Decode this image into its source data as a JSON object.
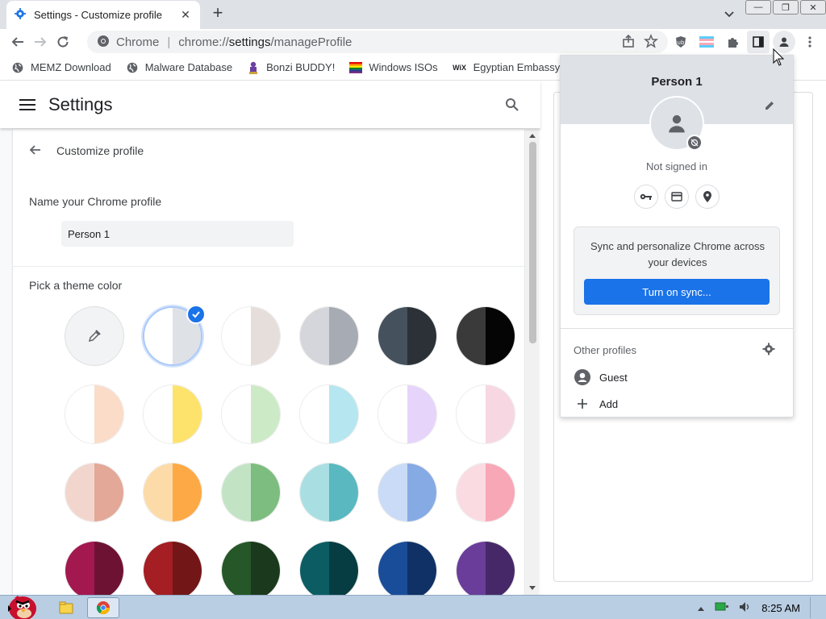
{
  "browser": {
    "tab": {
      "title": "Settings - Customize profile",
      "close": "✕",
      "icon": "gear-icon"
    },
    "new_tab": "+",
    "window_buttons": [
      "—",
      "❐",
      "✕"
    ],
    "omnibox": {
      "label": "Chrome",
      "separator": "|",
      "url_prefix": "chrome://",
      "url_highlight": "settings",
      "url_suffix": "/manageProfile"
    },
    "bookmarks": [
      {
        "label": "MEMZ Download",
        "icon": "globe-icon"
      },
      {
        "label": "Malware Database",
        "icon": "globe-icon"
      },
      {
        "label": "Bonzi BUDDY!",
        "icon": "bonzi-icon"
      },
      {
        "label": "Windows ISOs",
        "icon": "rainbow-flag-icon"
      },
      {
        "label": "Egyptian Embassy",
        "icon": "wix-icon",
        "icon_text": "WiX"
      }
    ]
  },
  "settings": {
    "header_title": "Settings",
    "page_title": "Customize profile",
    "name_label": "Name your Chrome profile",
    "name_value": "Person 1",
    "theme_label": "Pick a theme color",
    "swatches": [
      {
        "left": "#ffffff",
        "right": "#ffffff",
        "picker": true
      },
      {
        "left": "#ffffff",
        "right": "#dee1e6",
        "selected": true
      },
      {
        "left": "#ffffff",
        "right": "#e6dedb"
      },
      {
        "left": "#d4d6db",
        "right": "#a7abb3"
      },
      {
        "left": "#45515c",
        "right": "#2b3137"
      },
      {
        "left": "#3a3a3a",
        "right": "#050505"
      },
      {
        "left": "#ffffff",
        "right": "#fbdcc9"
      },
      {
        "left": "#ffffff",
        "right": "#fde36b"
      },
      {
        "left": "#ffffff",
        "right": "#cdeac6"
      },
      {
        "left": "#ffffff",
        "right": "#b6e6ef"
      },
      {
        "left": "#ffffff",
        "right": "#e6d4fb"
      },
      {
        "left": "#ffffff",
        "right": "#f7d7e2"
      },
      {
        "left": "#f2d6cd",
        "right": "#e3a898"
      },
      {
        "left": "#fddba8",
        "right": "#fda945"
      },
      {
        "left": "#c2e3c4",
        "right": "#7dbd7f"
      },
      {
        "left": "#a9dfe2",
        "right": "#5ab8c0"
      },
      {
        "left": "#c9dbf6",
        "right": "#86aae4"
      },
      {
        "left": "#fbdbe2",
        "right": "#f8a7b6"
      },
      {
        "left": "#a3184f",
        "right": "#6e1234"
      },
      {
        "left": "#a41e23",
        "right": "#721618"
      },
      {
        "left": "#255728",
        "right": "#1b3a1d"
      },
      {
        "left": "#0b5d63",
        "right": "#063d42"
      },
      {
        "left": "#1a4d99",
        "right": "#0f3165"
      },
      {
        "left": "#6a3d9a",
        "right": "#462868"
      }
    ]
  },
  "profile_popup": {
    "name": "Person 1",
    "status": "Not signed in",
    "sync_text": "Sync and personalize Chrome across your devices",
    "sync_button": "Turn on sync...",
    "other_profiles_label": "Other profiles",
    "profiles": [
      {
        "label": "Guest",
        "icon": "guest-account-icon"
      },
      {
        "label": "Add",
        "icon": "add-icon"
      }
    ]
  },
  "taskbar": {
    "time": "8:25 AM"
  },
  "colors": {
    "accent": "#1a73e8",
    "tabstrip": "#dee1e6",
    "taskbar": "#b9cde3"
  }
}
